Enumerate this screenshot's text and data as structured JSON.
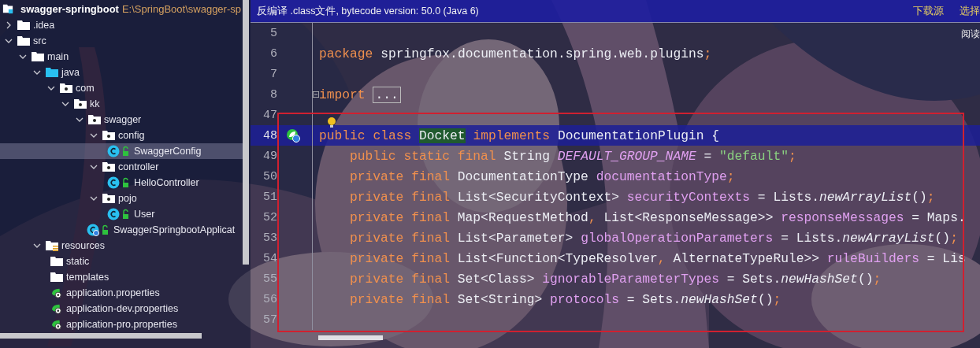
{
  "project": {
    "name": "swagger-springboot",
    "path": "E:\\SpringBoot\\swagger-sp"
  },
  "tree": [
    {
      "label": ".idea",
      "kind": "folder",
      "expanded": false,
      "selected": false
    },
    {
      "label": "src",
      "kind": "folder",
      "expanded": true,
      "selected": false,
      "children": [
        {
          "label": "main",
          "kind": "folder",
          "expanded": true,
          "selected": false,
          "children": [
            {
              "label": "java",
              "kind": "source",
              "expanded": true,
              "selected": false,
              "children": [
                {
                  "label": "com",
                  "kind": "package",
                  "expanded": true,
                  "selected": false,
                  "children": [
                    {
                      "label": "kk",
                      "kind": "package",
                      "expanded": true,
                      "selected": false,
                      "children": [
                        {
                          "label": "swagger",
                          "kind": "package",
                          "expanded": true,
                          "selected": false,
                          "children": [
                            {
                              "label": "config",
                              "kind": "package",
                              "expanded": true,
                              "selected": false,
                              "children": [
                                {
                                  "label": "SwaggerConfig",
                                  "kind": "class",
                                  "selected": true
                                }
                              ]
                            },
                            {
                              "label": "controller",
                              "kind": "package",
                              "expanded": true,
                              "selected": false,
                              "children": [
                                {
                                  "label": "HelloController",
                                  "kind": "class",
                                  "selected": false
                                }
                              ]
                            },
                            {
                              "label": "pojo",
                              "kind": "package",
                              "expanded": true,
                              "selected": false,
                              "children": [
                                {
                                  "label": "User",
                                  "kind": "class",
                                  "selected": false
                                }
                              ]
                            },
                            {
                              "label": "SwaggerSpringbootApplicat",
                              "kind": "app",
                              "selected": false
                            }
                          ]
                        }
                      ]
                    }
                  ]
                }
              ]
            },
            {
              "label": "resources",
              "kind": "resources",
              "expanded": true,
              "selected": false,
              "children": [
                {
                  "label": "static",
                  "kind": "plainfolder",
                  "selected": false
                },
                {
                  "label": "templates",
                  "kind": "plainfolder",
                  "selected": false
                },
                {
                  "label": "application.properties",
                  "kind": "properties",
                  "selected": false
                },
                {
                  "label": "application-dev.properties",
                  "kind": "properties",
                  "selected": false
                },
                {
                  "label": "application-pro.properties",
                  "kind": "properties",
                  "selected": false
                }
              ]
            }
          ]
        }
      ]
    }
  ],
  "banner": {
    "text": "反编译 .class文件, bytecode version: 50.0 (Java 6)",
    "links": [
      "下载源",
      "选择"
    ]
  },
  "reader_mode": "阅读",
  "code": [
    {
      "number": "5",
      "current": false
    },
    {
      "number": "6",
      "current": false,
      "tokens": [
        {
          "t": "package ",
          "kind": "kw"
        },
        {
          "t": "springfox.documentation.spring.web.plugins",
          "kind": "plain"
        },
        {
          "t": ";",
          "kind": "kw"
        }
      ]
    },
    {
      "number": "7",
      "current": false
    },
    {
      "number": "8",
      "current": false,
      "folded": true,
      "tokens": [
        {
          "t": "import ",
          "kind": "kw"
        },
        {
          "t": "...",
          "kind": "fold"
        }
      ]
    },
    {
      "number": "47",
      "current": false,
      "hint": true
    },
    {
      "number": "48",
      "current": true,
      "bean_marker": true,
      "tokens": [
        {
          "t": "public class ",
          "kind": "kw"
        },
        {
          "t": "Docket",
          "kind": "match"
        },
        {
          "t": " implements ",
          "kind": "kw"
        },
        {
          "t": "DocumentationPlugin {",
          "kind": "plain"
        }
      ]
    },
    {
      "number": "49",
      "current": false,
      "indented": true,
      "tokens": [
        {
          "t": "public static final ",
          "kind": "kw"
        },
        {
          "t": "String ",
          "kind": "plain"
        },
        {
          "t": "DEFAULT_GROUP_NAME",
          "kind": "const"
        },
        {
          "t": " = ",
          "kind": "plain"
        },
        {
          "t": "\"default\"",
          "kind": "str"
        },
        {
          "t": ";",
          "kind": "kw"
        }
      ]
    },
    {
      "number": "50",
      "current": false,
      "indented": true,
      "tokens": [
        {
          "t": "private final ",
          "kind": "kw"
        },
        {
          "t": "DocumentationType ",
          "kind": "plain"
        },
        {
          "t": "documentationType",
          "kind": "field"
        },
        {
          "t": ";",
          "kind": "kw"
        }
      ]
    },
    {
      "number": "51",
      "current": false,
      "indented": true,
      "tokens": [
        {
          "t": "private final ",
          "kind": "kw"
        },
        {
          "t": "List<SecurityContext> ",
          "kind": "plain"
        },
        {
          "t": "securityContexts",
          "kind": "field"
        },
        {
          "t": " = Lists.",
          "kind": "plain"
        },
        {
          "t": "newArrayList",
          "kind": "method"
        },
        {
          "t": "()",
          "kind": "plain"
        },
        {
          "t": ";",
          "kind": "kw"
        }
      ]
    },
    {
      "number": "52",
      "current": false,
      "indented": true,
      "tokens": [
        {
          "t": "private final ",
          "kind": "kw"
        },
        {
          "t": "Map<RequestMethod",
          "kind": "plain"
        },
        {
          "t": ",",
          "kind": "kw"
        },
        {
          "t": " List<ResponseMessage>> ",
          "kind": "plain"
        },
        {
          "t": "responseMessages",
          "kind": "field"
        },
        {
          "t": " = Maps.",
          "kind": "plain"
        }
      ]
    },
    {
      "number": "53",
      "current": false,
      "indented": true,
      "tokens": [
        {
          "t": "private final ",
          "kind": "kw"
        },
        {
          "t": "List<Parameter> ",
          "kind": "plain"
        },
        {
          "t": "globalOperationParameters",
          "kind": "field"
        },
        {
          "t": " = Lists.",
          "kind": "plain"
        },
        {
          "t": "newArrayList",
          "kind": "method"
        },
        {
          "t": "()",
          "kind": "plain"
        },
        {
          "t": ";",
          "kind": "kw"
        }
      ]
    },
    {
      "number": "54",
      "current": false,
      "indented": true,
      "tokens": [
        {
          "t": "private final ",
          "kind": "kw"
        },
        {
          "t": "List<Function<TypeResolver",
          "kind": "plain"
        },
        {
          "t": ",",
          "kind": "kw"
        },
        {
          "t": " AlternateTypeRule>> ",
          "kind": "plain"
        },
        {
          "t": "ruleBuilders",
          "kind": "field"
        },
        {
          "t": " = Lis",
          "kind": "plain"
        }
      ]
    },
    {
      "number": "55",
      "current": false,
      "indented": true,
      "tokens": [
        {
          "t": "private final ",
          "kind": "kw"
        },
        {
          "t": "Set<Class> ",
          "kind": "plain"
        },
        {
          "t": "ignorableParameterTypes",
          "kind": "field"
        },
        {
          "t": " = Sets.",
          "kind": "plain"
        },
        {
          "t": "newHashSet",
          "kind": "method"
        },
        {
          "t": "()",
          "kind": "plain"
        },
        {
          "t": ";",
          "kind": "kw"
        }
      ]
    },
    {
      "number": "56",
      "current": false,
      "indented": true,
      "tokens": [
        {
          "t": "private final ",
          "kind": "kw"
        },
        {
          "t": "Set<String> ",
          "kind": "plain"
        },
        {
          "t": "protocols",
          "kind": "field"
        },
        {
          "t": " = Sets.",
          "kind": "plain"
        },
        {
          "t": "newHashSet",
          "kind": "method"
        },
        {
          "t": "()",
          "kind": "plain"
        },
        {
          "t": ";",
          "kind": "kw"
        }
      ]
    },
    {
      "number": "57",
      "current": false
    }
  ]
}
